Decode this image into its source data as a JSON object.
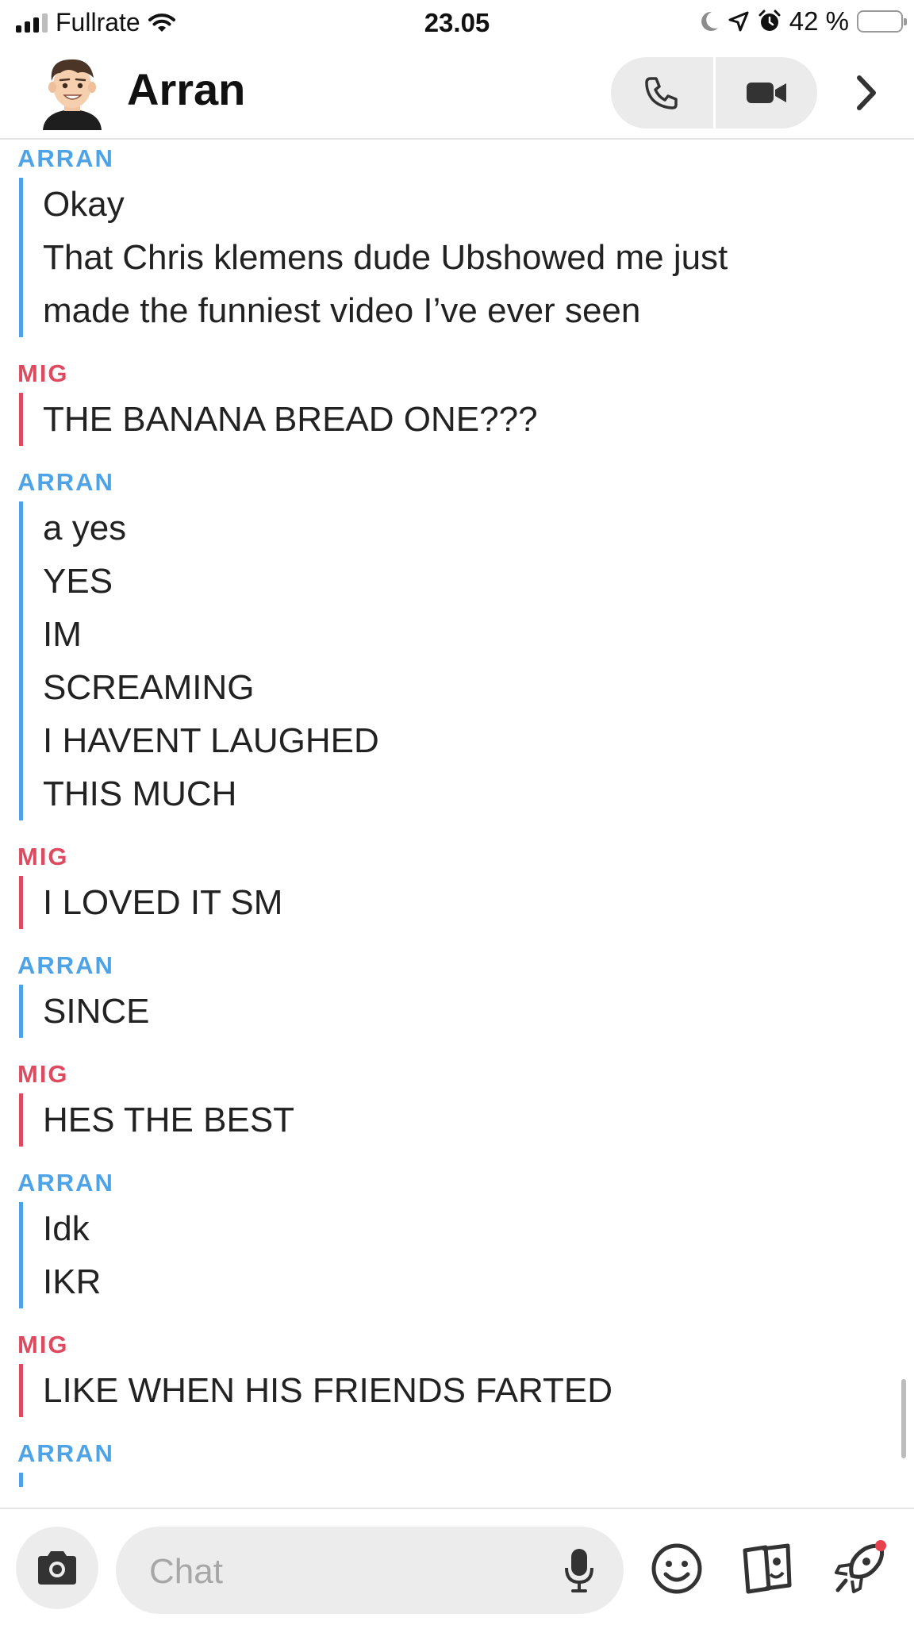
{
  "status_bar": {
    "carrier": "Fullrate",
    "time": "23.05",
    "battery_percent": "42 %",
    "battery_level": 0.42
  },
  "header": {
    "contact_name": "Arran"
  },
  "messages": [
    {
      "sender": "ARRAN",
      "lines": [
        "Okay",
        "That Chris klemens dude Ubshowed me just",
        "made the funniest video I’ve ever seen"
      ]
    },
    {
      "sender": "MIG",
      "lines": [
        "THE BANANA BREAD ONE???"
      ]
    },
    {
      "sender": "ARRAN",
      "lines": [
        "a yes",
        "YES",
        "IM",
        "SCREAMING",
        "I HAVENT LAUGHED",
        "THIS MUCH"
      ]
    },
    {
      "sender": "MIG",
      "lines": [
        "I LOVED IT SM"
      ]
    },
    {
      "sender": "ARRAN",
      "lines": [
        "SINCE"
      ]
    },
    {
      "sender": "MIG",
      "lines": [
        "HES THE BEST"
      ]
    },
    {
      "sender": "ARRAN",
      "lines": [
        "Idk",
        "IKR"
      ]
    },
    {
      "sender": "MIG",
      "lines": [
        "LIKE WHEN HIS FRIENDS FARTED"
      ]
    },
    {
      "sender": "ARRAN",
      "lines": []
    }
  ],
  "composer": {
    "placeholder": "Chat"
  },
  "colors": {
    "arran": "#4ea2e6",
    "mig": "#dc4b5f",
    "notification_dot": "#e8414b"
  },
  "icons": {
    "header": [
      "phone-icon",
      "video-camera-icon",
      "chevron-right-icon"
    ],
    "composer": [
      "camera-icon",
      "microphone-icon",
      "smiley-icon",
      "cards-icon",
      "rocket-icon"
    ]
  }
}
